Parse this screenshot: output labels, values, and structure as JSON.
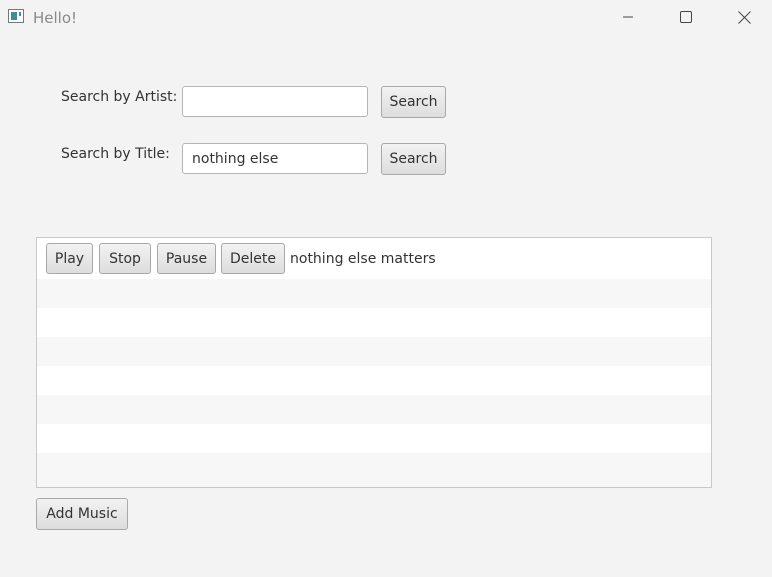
{
  "window": {
    "title": "Hello!",
    "icon": "app-window-icon",
    "controls": [
      "minimize-icon",
      "maximize-icon",
      "close-icon"
    ]
  },
  "search": {
    "artist_label": "Search by Artist:",
    "artist_value": "",
    "artist_button": "Search",
    "title_label": "Search by Title:",
    "title_value": "nothing else",
    "title_button": "Search"
  },
  "list": {
    "items": [
      {
        "play_label": "Play",
        "stop_label": "Stop",
        "pause_label": "Pause",
        "delete_label": "Delete",
        "title": "nothing else matters"
      }
    ]
  },
  "footer": {
    "add_music_label": "Add Music"
  },
  "colors": {
    "background": "#f3f3f3",
    "row_alt": "#f7f7f7",
    "button_border": "#a8a8a8"
  }
}
